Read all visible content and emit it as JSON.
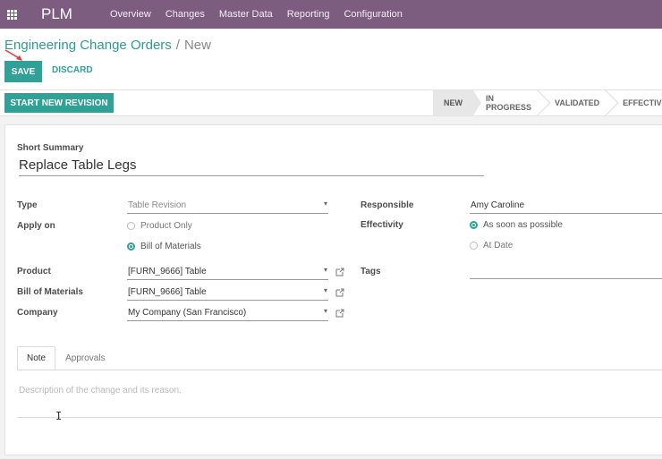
{
  "topbar": {
    "app_name": "PLM",
    "menu": [
      "Overview",
      "Changes",
      "Master Data",
      "Reporting",
      "Configuration"
    ]
  },
  "breadcrumb": {
    "parent": "Engineering Change Orders",
    "separator": "/",
    "current": "New"
  },
  "actions": {
    "save": "SAVE",
    "discard": "DISCARD"
  },
  "statusbar": {
    "revision_button": "START NEW REVISION",
    "stages": [
      "NEW",
      "IN PROGRESS",
      "VALIDATED",
      "EFFECTIVE"
    ],
    "active_stage": "NEW"
  },
  "form": {
    "short_summary_label": "Short Summary",
    "short_summary_value": "Replace Table Legs",
    "type_label": "Type",
    "type_value": "Table Revision",
    "apply_on_label": "Apply on",
    "apply_on_options": [
      "Product Only",
      "Bill of Materials"
    ],
    "apply_on_selected": "Bill of Materials",
    "product_label": "Product",
    "product_value": "[FURN_9666] Table",
    "bom_label": "Bill of Materials",
    "bom_value": "[FURN_9666] Table",
    "company_label": "Company",
    "company_value": "My Company (San Francisco)",
    "responsible_label": "Responsible",
    "responsible_value": "Amy Caroline",
    "effectivity_label": "Effectivity",
    "effectivity_options": [
      "As soon as possible",
      "At Date"
    ],
    "effectivity_selected": "As soon as possible",
    "tags_label": "Tags",
    "tags_value": ""
  },
  "notebook": {
    "tabs": [
      "Note",
      "Approvals"
    ],
    "active_tab": "Note",
    "note_placeholder": "Description of the change and its reason."
  },
  "colors": {
    "topbar": "#7c5c7f",
    "primary": "#2fa197",
    "link": "#2a9d8f"
  }
}
